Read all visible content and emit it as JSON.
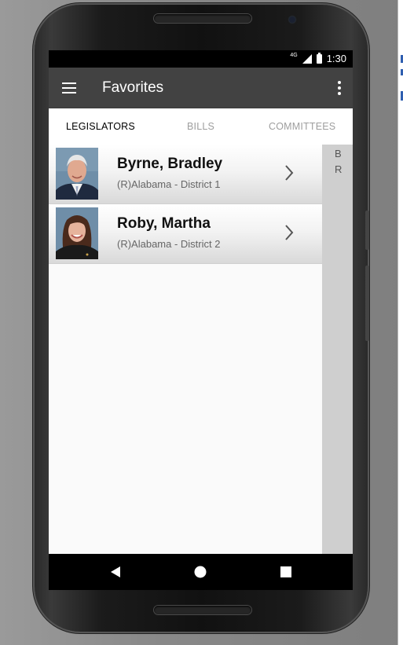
{
  "status_bar": {
    "network": "4G",
    "time": "1:30"
  },
  "app_bar": {
    "title": "Favorites",
    "menu_icon": "menu-icon",
    "overflow_icon": "more-vert-icon"
  },
  "tabs": [
    {
      "label": "LEGISLATORS",
      "active": true
    },
    {
      "label": "BILLS",
      "active": false
    },
    {
      "label": "COMMITTEES",
      "active": false
    }
  ],
  "legislators": [
    {
      "name": "Byrne, Bradley",
      "detail": "(R)Alabama - District 1"
    },
    {
      "name": "Roby, Martha",
      "detail": "(R)Alabama - District 2"
    }
  ],
  "side_panel": {
    "letters": [
      "B",
      "R"
    ]
  },
  "nav_bar": {
    "back_icon": "back-triangle-icon",
    "home_icon": "home-circle-icon",
    "recents_icon": "recents-square-icon"
  },
  "colors": {
    "app_bar": "#424242",
    "tab_active": "#000000",
    "tab_inactive": "#9e9e9e",
    "list_background": "#fafafa",
    "side_panel": "#cfcfcf"
  }
}
